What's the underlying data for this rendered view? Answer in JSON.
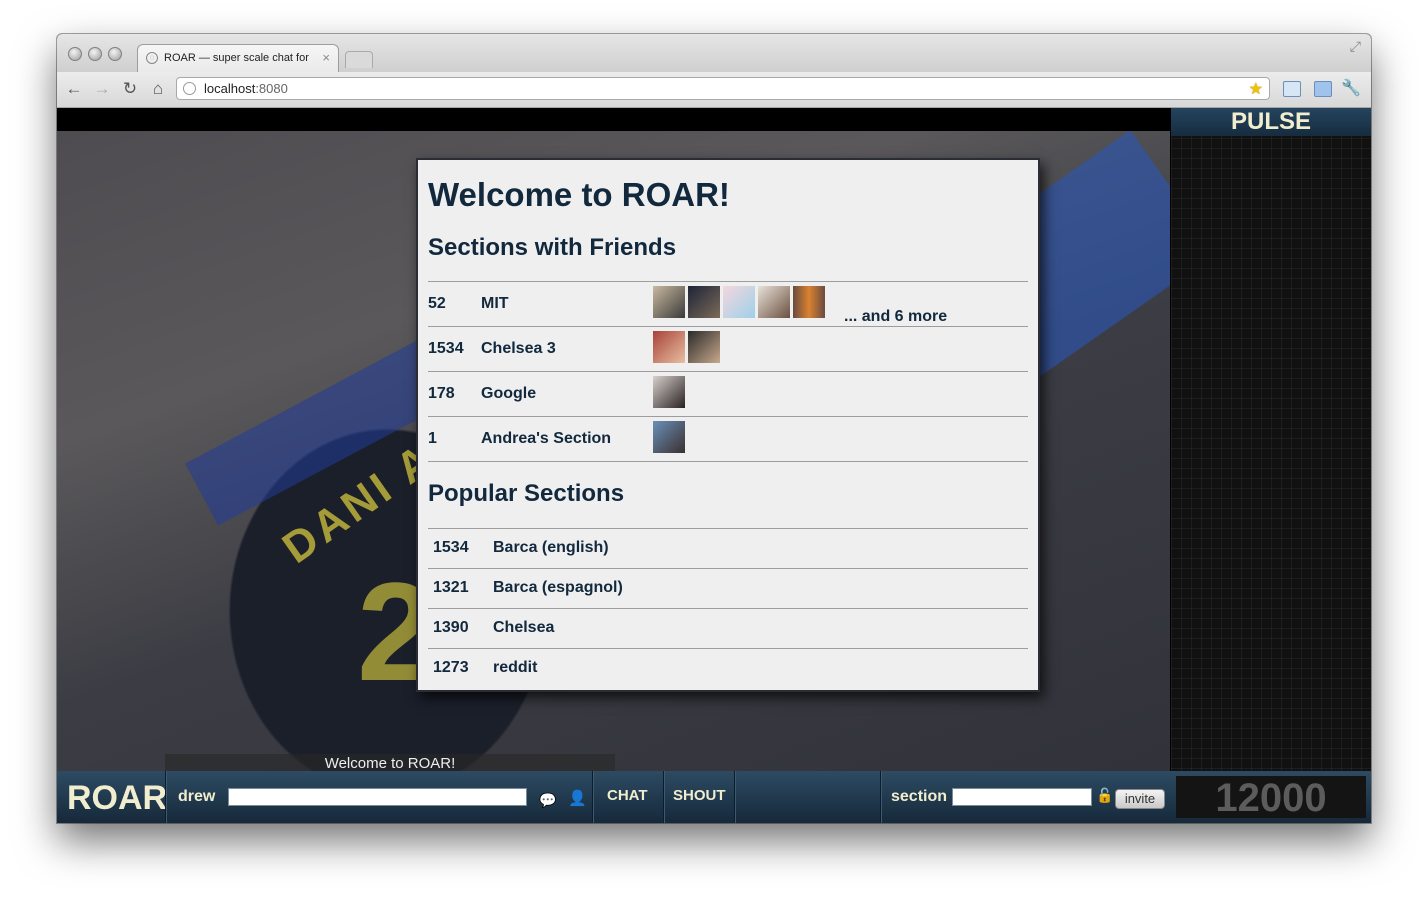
{
  "browser": {
    "tab_title": "ROAR — super scale chat for",
    "url_host": "localhost",
    "url_port": ":8080"
  },
  "pulse": {
    "title": "PULSE"
  },
  "ticker": {
    "text": "Welcome to ROAR!"
  },
  "modal": {
    "title": "Welcome to ROAR!",
    "friends_heading": "Sections with Friends",
    "friends_sections": [
      {
        "count": "52",
        "name": "MIT",
        "avatars": 5,
        "more": "... and 6 more"
      },
      {
        "count": "1534",
        "name": "Chelsea 3",
        "avatars": 2
      },
      {
        "count": "178",
        "name": "Google",
        "avatars": 1
      },
      {
        "count": "1",
        "name": "Andrea's Section",
        "avatars": 1
      }
    ],
    "popular_heading": "Popular Sections",
    "popular_sections": [
      {
        "count": "1534",
        "name": "Barca (english)"
      },
      {
        "count": "1321",
        "name": "Barca (espagnol)"
      },
      {
        "count": "1390",
        "name": "Chelsea"
      },
      {
        "count": "1273",
        "name": "reddit"
      }
    ]
  },
  "bottombar": {
    "logo": "ROAR",
    "username": "drew",
    "chat_value": "",
    "chat_button": "CHAT",
    "shout_button": "SHOUT",
    "section_label": "section",
    "section_value": "",
    "invite_label": "invite",
    "counter": "12000"
  },
  "colors": {
    "accent_text": "#f1edcf",
    "bar_top": "#2d4b63",
    "bar_bottom": "#16293a",
    "modal_text": "#12283d"
  }
}
